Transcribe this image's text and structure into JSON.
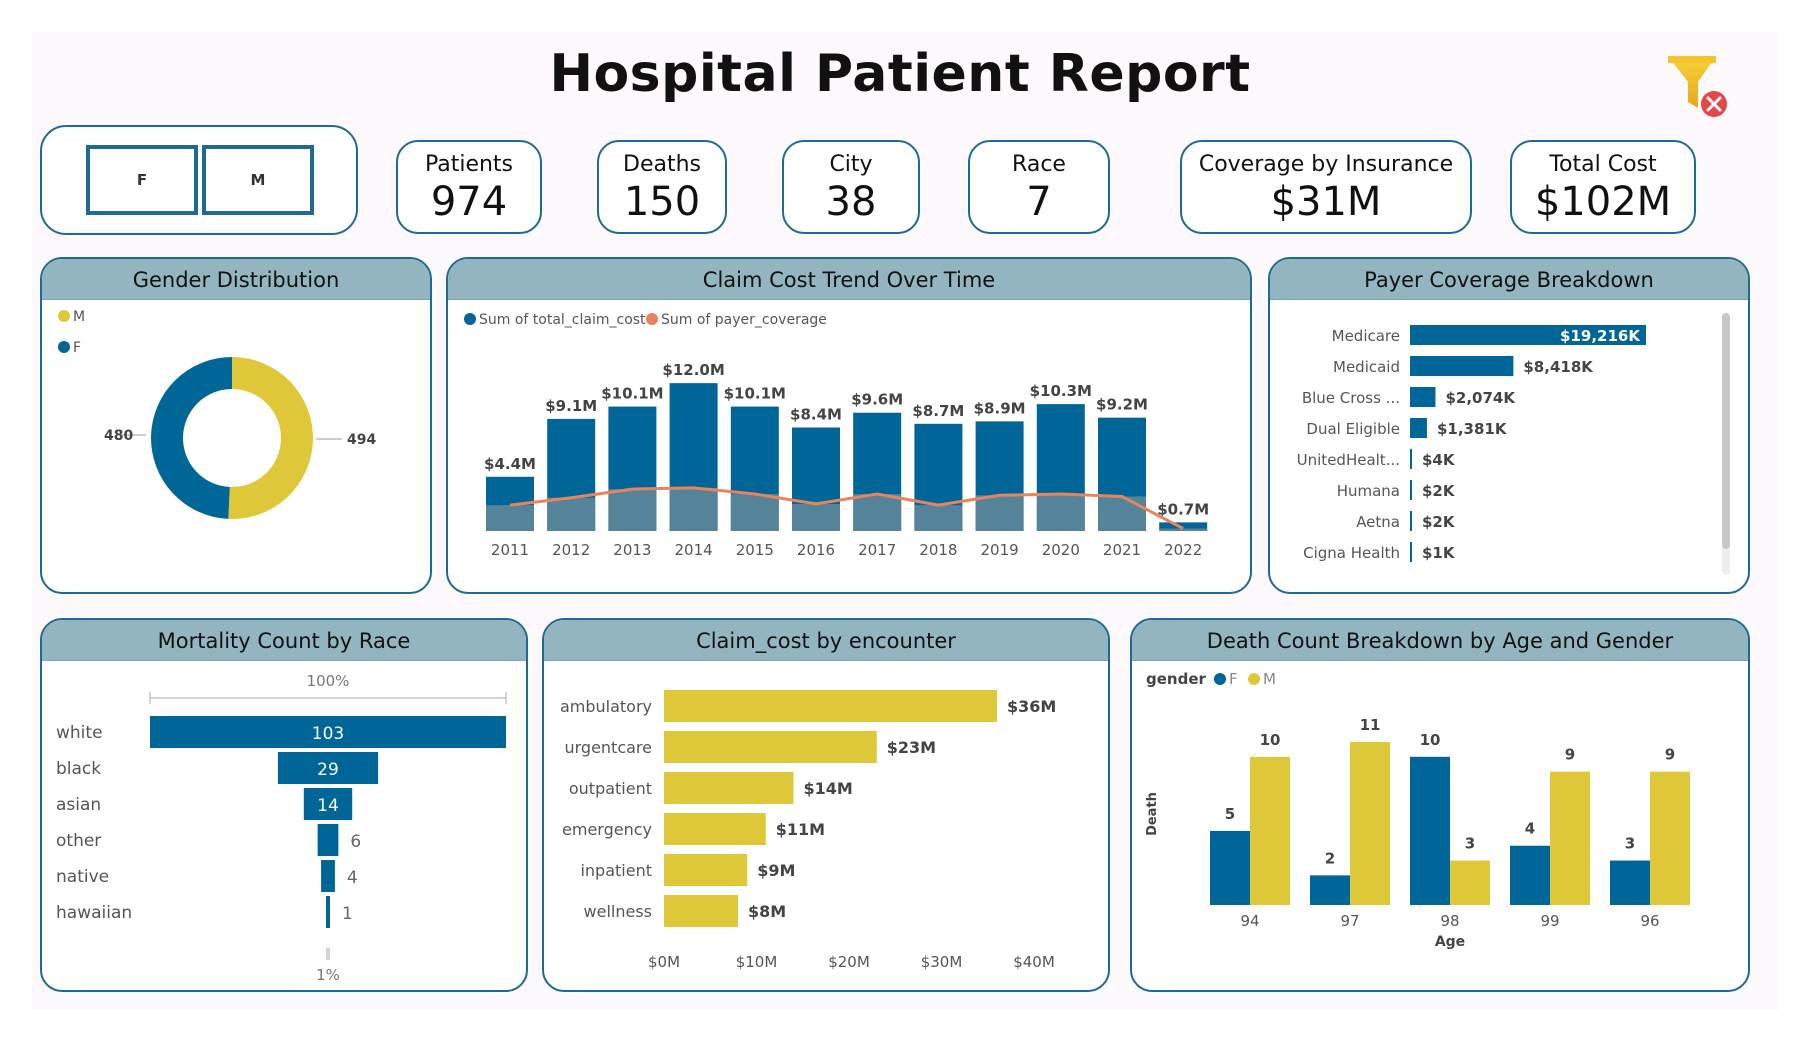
{
  "title": "Hospital Patient Report",
  "colors": {
    "blue": "#006698",
    "yellow": "#dfc73a",
    "orange": "#e8845d",
    "header": "#93b5bf",
    "border": "#1e6a92"
  },
  "slicer": {
    "options": [
      "F",
      "M"
    ]
  },
  "kpis": [
    {
      "label": "Patients",
      "value": "974"
    },
    {
      "label": "Deaths",
      "value": "150"
    },
    {
      "label": "City",
      "value": "38"
    },
    {
      "label": "Race",
      "value": "7"
    },
    {
      "label": "Coverage by Insurance",
      "value": "$31M"
    },
    {
      "label": "Total Cost",
      "value": "$102M"
    }
  ],
  "icons": {
    "filter": "clear-filter-icon"
  },
  "chart_data": [
    {
      "id": "gender",
      "type": "pie",
      "title": "Gender Distribution",
      "legend": [
        "M",
        "F"
      ],
      "slices": [
        {
          "name": "M",
          "value": 494,
          "label": "494"
        },
        {
          "name": "F",
          "value": 480,
          "label": "480"
        }
      ]
    },
    {
      "id": "claim_trend",
      "type": "bar",
      "title": "Claim Cost Trend Over Time",
      "legend": [
        "Sum of total_claim_cost",
        "Sum of payer_coverage"
      ],
      "categories": [
        "2011",
        "2012",
        "2013",
        "2014",
        "2015",
        "2016",
        "2017",
        "2018",
        "2019",
        "2020",
        "2021",
        "2022"
      ],
      "series": [
        {
          "name": "Sum of total_claim_cost",
          "values": [
            4.4,
            9.1,
            10.1,
            12.0,
            10.1,
            8.4,
            9.6,
            8.7,
            8.9,
            10.3,
            9.2,
            0.7
          ],
          "labels": [
            "$4.4M",
            "$9.1M",
            "$10.1M",
            "$12.0M",
            "$10.1M",
            "$8.4M",
            "$9.6M",
            "$8.7M",
            "$8.9M",
            "$10.3M",
            "$9.2M",
            "$0.7M"
          ]
        },
        {
          "name": "Sum of payer_coverage",
          "values": [
            2.1,
            2.7,
            3.4,
            3.5,
            3.0,
            2.2,
            3.0,
            2.1,
            2.9,
            3.0,
            2.8,
            0.2
          ]
        }
      ],
      "ylim": [
        0,
        12.5
      ]
    },
    {
      "id": "payer",
      "type": "bar",
      "orientation": "horizontal",
      "title": "Payer Coverage Breakdown",
      "categories": [
        "Medicare",
        "Medicaid",
        "Blue Cross ...",
        "Dual Eligible",
        "UnitedHealt...",
        "Humana",
        "Aetna",
        "Cigna Health"
      ],
      "values": [
        19216,
        8418,
        2074,
        1381,
        4,
        2,
        2,
        1
      ],
      "labels": [
        "$19,216K",
        "$8,418K",
        "$2,074K",
        "$1,381K",
        "$4K",
        "$2K",
        "$2K",
        "$1K"
      ]
    },
    {
      "id": "mortality",
      "type": "bar",
      "orientation": "funnel",
      "title": "Mortality Count by Race",
      "categories": [
        "white",
        "black",
        "asian",
        "other",
        "native",
        "hawaiian"
      ],
      "values": [
        103,
        29,
        14,
        6,
        4,
        1
      ],
      "top_label": "100%",
      "bottom_label": "1%"
    },
    {
      "id": "encounter",
      "type": "bar",
      "orientation": "horizontal",
      "title": "Claim_cost by encounter",
      "categories": [
        "ambulatory",
        "urgentcare",
        "outpatient",
        "emergency",
        "inpatient",
        "wellness"
      ],
      "values": [
        36,
        23,
        14,
        11,
        9,
        8
      ],
      "labels": [
        "$36M",
        "$23M",
        "$14M",
        "$11M",
        "$9M",
        "$8M"
      ],
      "xticks": [
        "$0M",
        "$10M",
        "$20M",
        "$30M",
        "$40M"
      ],
      "xlim": [
        0,
        40
      ]
    },
    {
      "id": "death_age",
      "type": "bar",
      "title": "Death Count Breakdown by Age and Gender",
      "legend_title": "gender",
      "legend": [
        "F",
        "M"
      ],
      "categories": [
        "94",
        "97",
        "98",
        "99",
        "96"
      ],
      "series": [
        {
          "name": "F",
          "values": [
            5,
            2,
            10,
            4,
            3
          ]
        },
        {
          "name": "M",
          "values": [
            10,
            11,
            3,
            9,
            9
          ]
        }
      ],
      "xlabel": "Age",
      "ylabel": "Death",
      "ylim": [
        0,
        11
      ]
    }
  ]
}
